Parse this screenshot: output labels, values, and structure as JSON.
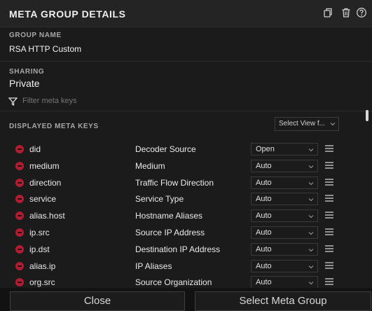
{
  "panel": {
    "title": "META GROUP DETAILS",
    "icons": [
      "copy-icon",
      "trash-icon",
      "help-icon"
    ]
  },
  "group_name": {
    "label": "GROUP NAME",
    "value": "RSA HTTP Custom"
  },
  "sharing": {
    "label": "SHARING",
    "value": "Private"
  },
  "filter": {
    "placeholder": "Filter meta keys",
    "icon": "filter-icon"
  },
  "displayed": {
    "label": "DISPLAYED META KEYS",
    "select_view": "Select View f...",
    "rows": [
      {
        "key": "did",
        "desc": "Decoder Source",
        "mode": "Open"
      },
      {
        "key": "medium",
        "desc": "Medium",
        "mode": "Auto"
      },
      {
        "key": "direction",
        "desc": "Traffic Flow Direction",
        "mode": "Auto"
      },
      {
        "key": "service",
        "desc": "Service Type",
        "mode": "Auto"
      },
      {
        "key": "alias.host",
        "desc": "Hostname Aliases",
        "mode": "Auto"
      },
      {
        "key": "ip.src",
        "desc": "Source IP Address",
        "mode": "Auto"
      },
      {
        "key": "ip.dst",
        "desc": "Destination IP Address",
        "mode": "Auto"
      },
      {
        "key": "alias.ip",
        "desc": "IP Aliases",
        "mode": "Auto"
      },
      {
        "key": "org.src",
        "desc": "Source Organization",
        "mode": "Auto"
      }
    ]
  },
  "footer": {
    "close": "Close",
    "select": "Select Meta Group"
  },
  "colors": {
    "remove": "#b01c30",
    "background": "#1b1b1b"
  }
}
